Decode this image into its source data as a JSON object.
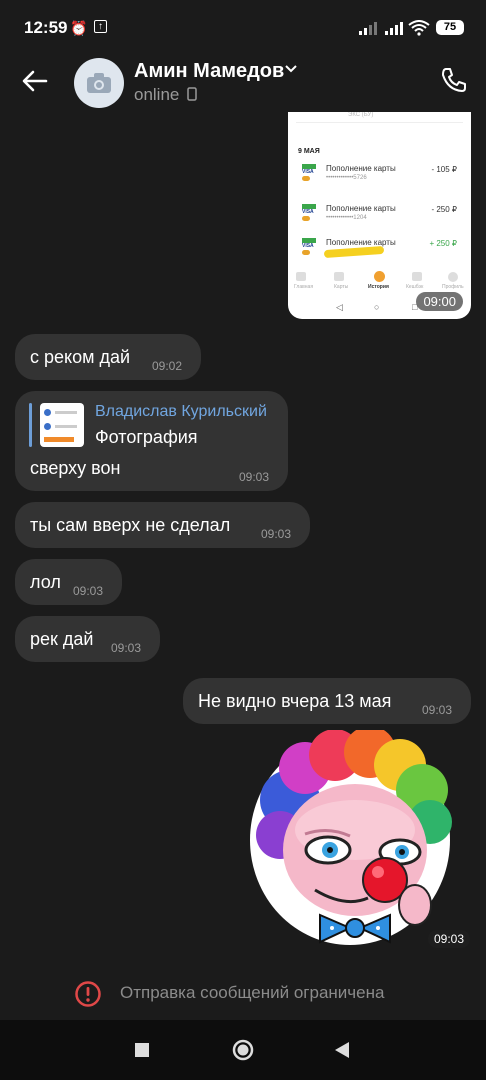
{
  "status_bar": {
    "time": "12:59",
    "battery": "75"
  },
  "contact": {
    "name": "Амин Мамедов",
    "status": "online"
  },
  "photo_message": {
    "header": "9 МАЯ",
    "rows": [
      {
        "name": "Пополнение карты",
        "sub": "•••••••••••••5726",
        "amount": "- 105 ₽",
        "positive": false
      },
      {
        "name": "Пополнение карты",
        "sub": "•••••••••••••1204",
        "amount": "- 250 ₽",
        "positive": false
      },
      {
        "name": "Пополнение карты",
        "sub": "",
        "amount": "+ 250 ₽",
        "positive": true
      }
    ],
    "tabs": [
      "Главная",
      "Карты",
      "История",
      "Кешбэк",
      "Профиль"
    ],
    "time": "09:00"
  },
  "messages": [
    {
      "text": "с реком дай",
      "time": "09:02"
    },
    {
      "reply_author": "Владислав Курильский",
      "reply_type": "Фотография",
      "text": "сверху вон",
      "time": "09:03"
    },
    {
      "text": "ты сам вверх не сделал",
      "time": "09:03"
    },
    {
      "text": "лол",
      "time": "09:03"
    },
    {
      "text": "рек дай",
      "time": "09:03"
    },
    {
      "text": "Не видно вчера 13 мая",
      "time": "09:03"
    }
  ],
  "sticker": {
    "time": "09:03"
  },
  "restriction": {
    "text": "Отправка сообщений ограничена"
  },
  "colors": {
    "background": "#1b1b1b",
    "bubble": "#333333",
    "accent": "#71a6e0",
    "warning": "#e04848"
  }
}
